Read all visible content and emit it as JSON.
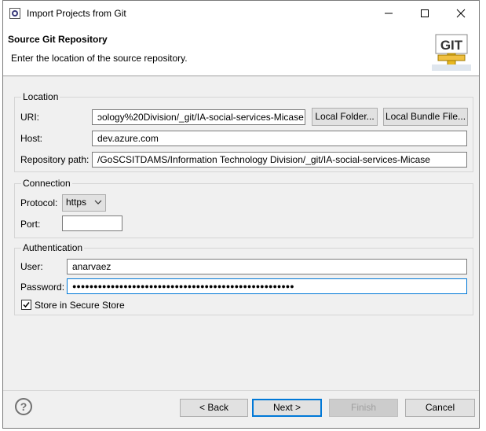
{
  "window": {
    "title": "Import Projects from Git",
    "controls": {
      "minimize": "—",
      "maximize": "☐",
      "close": "✕"
    }
  },
  "header": {
    "title": "Source Git Repository",
    "description": "Enter the location of the source repository.",
    "logo_text": "GIT"
  },
  "location": {
    "group_label": "Location",
    "uri_label": "URI:",
    "uri_value": "ɔology%20Division/_git/IA-social-services-Micase",
    "local_folder_button": "Local Folder...",
    "local_bundle_button": "Local Bundle File...",
    "host_label": "Host:",
    "host_value": "dev.azure.com",
    "repo_path_label": "Repository path:",
    "repo_path_value": "/GoSCSITDAMS/Information Technology Division/_git/IA-social-services-Micase"
  },
  "connection": {
    "group_label": "Connection",
    "protocol_label": "Protocol:",
    "protocol_value": "https",
    "port_label": "Port:",
    "port_value": ""
  },
  "authentication": {
    "group_label": "Authentication",
    "user_label": "User:",
    "user_value": "anarvaez",
    "password_label": "Password:",
    "password_value": "●●●●●●●●●●●●●●●●●●●●●●●●●●●●●●●●●●●●●●●●●●●●●●●●●●●●",
    "store_label": "Store in Secure Store",
    "store_checked": "✓"
  },
  "footer": {
    "help": "?",
    "back": "< Back",
    "next": "Next >",
    "finish": "Finish",
    "cancel": "Cancel"
  },
  "colors": {
    "accent": "#0078d7",
    "dialog_bg": "#f0f0f0",
    "header_bg": "#ffffff"
  }
}
